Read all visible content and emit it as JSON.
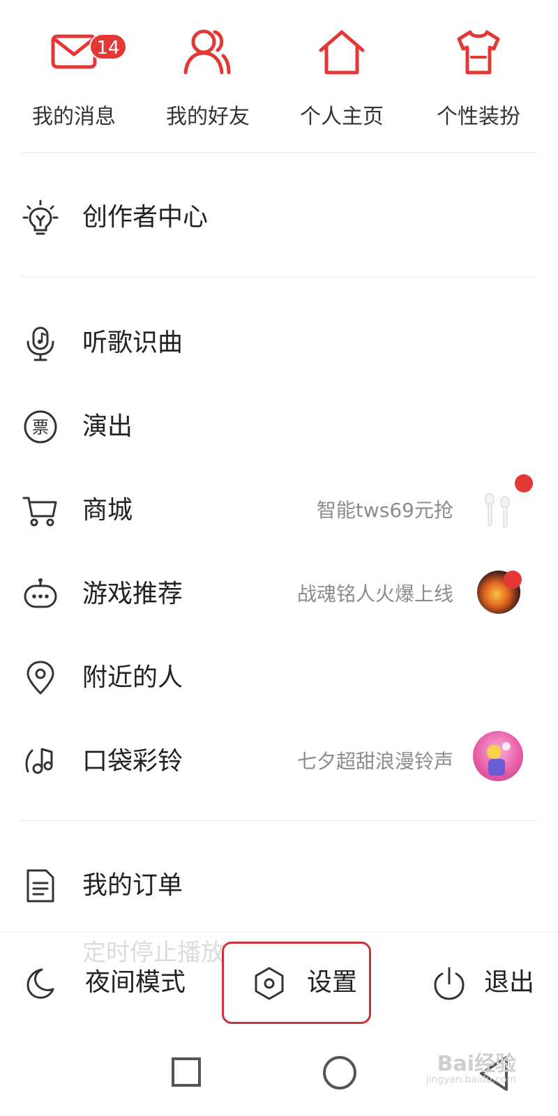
{
  "quick_actions": [
    {
      "label": "我的消息",
      "icon": "mail-icon",
      "badge": "14"
    },
    {
      "label": "我的好友",
      "icon": "friends-icon"
    },
    {
      "label": "个人主页",
      "icon": "home-icon"
    },
    {
      "label": "个性装扮",
      "icon": "shirt-icon"
    }
  ],
  "creator_center": {
    "label": "创作者中心",
    "icon": "lightbulb-icon"
  },
  "menu": [
    {
      "label": "听歌识曲",
      "icon": "microphone-music-icon"
    },
    {
      "label": "演出",
      "icon": "ticket-icon"
    },
    {
      "label": "商城",
      "icon": "cart-icon",
      "subtitle": "智能tws69元抢"
    },
    {
      "label": "游戏推荐",
      "icon": "gamepad-icon",
      "subtitle": "战魂铭人火爆上线"
    },
    {
      "label": "附近的人",
      "icon": "location-pin-icon"
    },
    {
      "label": "口袋彩铃",
      "icon": "ringtone-icon",
      "subtitle": "七夕超甜浪漫铃声"
    }
  ],
  "orders": {
    "label": "我的订单",
    "icon": "document-icon"
  },
  "bottom_bar": {
    "ghost_text": "定时停止播放",
    "night_mode": "夜间模式",
    "settings": "设置",
    "logout": "退出"
  },
  "watermark": {
    "text": "Bai经验",
    "sub": "jingyan.baidu.com"
  },
  "colors": {
    "accent": "#e43837",
    "text": "#222222",
    "subtext": "#8c8c8c",
    "highlight_box": "#c9343a"
  }
}
